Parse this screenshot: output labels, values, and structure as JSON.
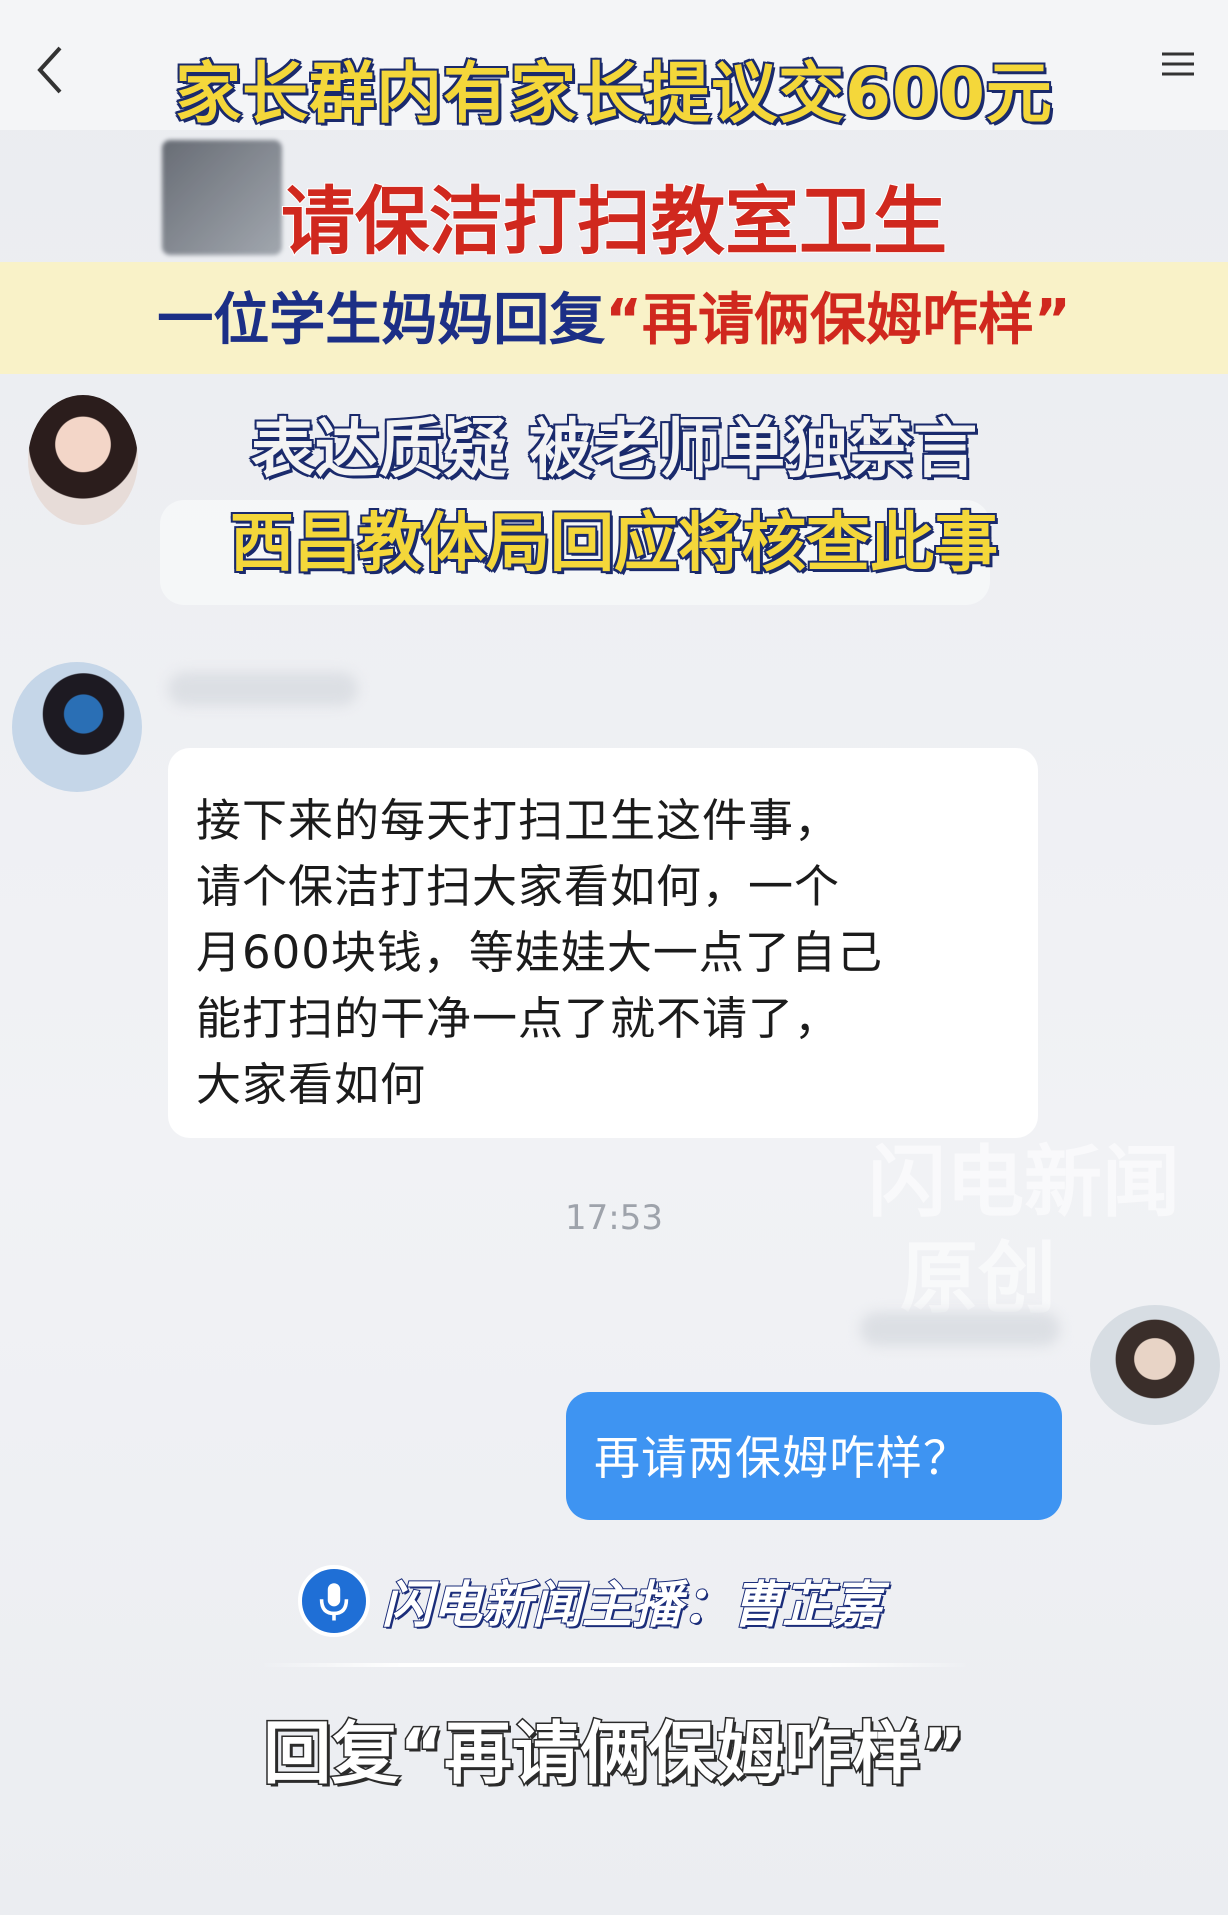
{
  "headline": {
    "line1": "家长群内有家长提议交600元",
    "line2": "请保洁打扫教室卫生",
    "line3_prefix": "一位学生妈妈回复",
    "line3_quote": "“再请俩保姆咋样”",
    "line4": "表达质疑 被老师单独禁言",
    "line5": "西昌教体局回应将核查此事"
  },
  "chat": {
    "incoming_message": {
      "lines": [
        "接下来的每天打扫卫生这件事，",
        "请个保洁打扫大家看如何，一个",
        "月600块钱，等娃娃大一点了自己",
        "能打扫的干净一点了就不请了，",
        "大家看如何"
      ]
    },
    "timestamp": "17:53",
    "outgoing_message": "再请两保姆咋样？"
  },
  "watermark": {
    "line1": "闪电新闻",
    "line2": "原创"
  },
  "anchor_credit": "闪电新闻主播：曹芷嘉",
  "subtitle": "回复“再请俩保姆咋样”",
  "colors": {
    "outgoing_bubble": "#3e94f2",
    "headline_yellow": "#f4d73a",
    "headline_red": "#d0281e",
    "headline_outline": "#1a2a6c"
  },
  "icons": [
    "back-arrow-icon",
    "menu-icon",
    "microphone-icon"
  ]
}
